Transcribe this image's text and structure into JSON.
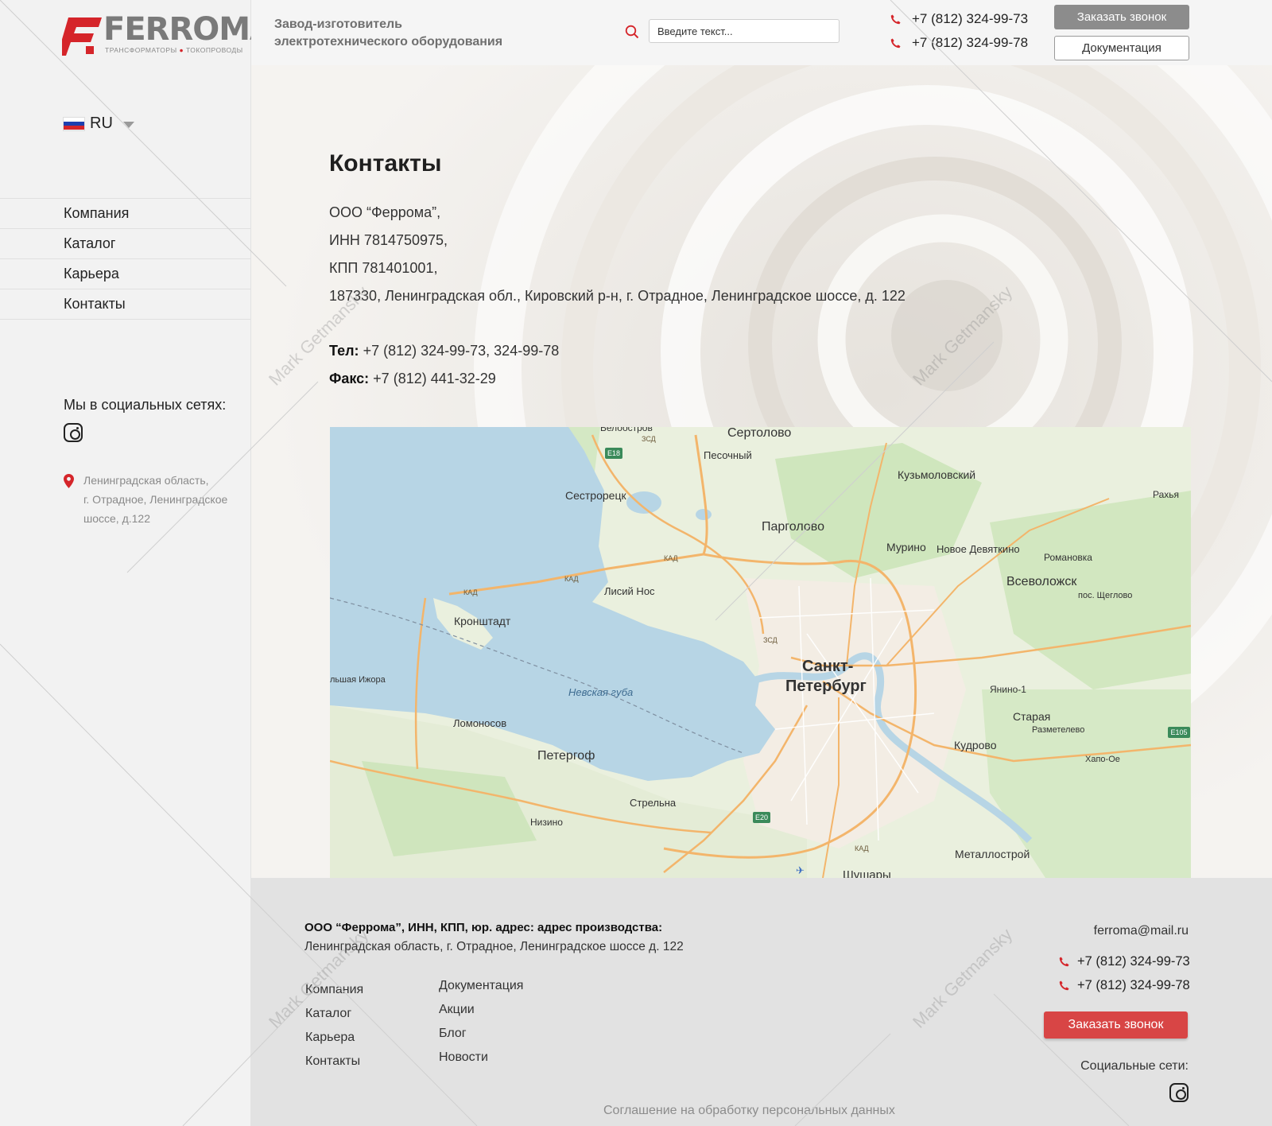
{
  "brand": {
    "name": "FERROMA",
    "sub_left": "ТРАНСФОРМАТОРЫ",
    "sub_right": "ТОКОПРОВОДЫ",
    "accent": "#d5252a"
  },
  "header": {
    "tagline_line1": "Завод-изготовитель",
    "tagline_line2": "электротехнического оборудования",
    "search_placeholder": "Введите текст...",
    "phones": [
      "+7 (812) 324-99-73",
      "+7 (812) 324-99-78"
    ],
    "callback_label": "Заказать звонок",
    "docs_label": "Документация"
  },
  "language": {
    "code": "RU",
    "flag": "russia-flag"
  },
  "sidebar": {
    "nav": [
      "Компания",
      "Каталог",
      "Карьера",
      "Контакты"
    ],
    "social_title": "Мы в социальных сетях:",
    "address_lines": [
      "Ленинградская область,",
      "г. Отрадное, Ленинградское",
      "шоссе, д.122"
    ]
  },
  "contacts": {
    "title": "Контакты",
    "company": "ООО “Феррома”,",
    "inn": "ИНН 7814750975,",
    "kpp": "КПП 781401001,",
    "address": "187330, Ленинградская обл., Кировский р-н, г. Отрадное, Ленинградское шоссе, д. 122",
    "tel_label": "Тел:",
    "tel_value": "+7 (812) 324-99-73, 324-99-78",
    "fax_label": "Факс:",
    "fax_value": "+7 (812) 441-32-29"
  },
  "map": {
    "labels": {
      "beloostrov": "Белоостров",
      "sertolovo": "Сертолово",
      "pesochny": "Песочный",
      "kuzmolovsky": "Кузьмоловский",
      "rakhya": "Рахья",
      "sestroretsk": "Сестрорецк",
      "pargolovo": "Парголово",
      "murino": "Мурино",
      "novoe_devyatkino": "Новое Девяткино",
      "romanovka": "Романовка",
      "vsevolozhsk": "Всеволожск",
      "shcheglovo": "пос. Щеглово",
      "lisiy_nos": "Лисий Нос",
      "kronshtadt": "Кронштадт",
      "spb_line1": "Санкт-",
      "spb_line2": "Петербург",
      "yanino": "Янино-1",
      "staraya": "Старая",
      "razmetelevo": "Разметелево",
      "bolshaya_izhora": "льшая Ижора",
      "nevskaya_guba": "Невская губа",
      "lomonosov": "Ломоносов",
      "peterhof": "Петергоф",
      "kudrovo": "Кудрово",
      "khapo_oe": "Хапо-Ое",
      "strelna": "Стрельна",
      "nizino": "Низино",
      "metallostroy": "Металлострой",
      "shushary": "Шушары",
      "kad": "КАД",
      "zsd": "ЗСД",
      "e18": "E18",
      "e20": "E20",
      "e105": "E105"
    }
  },
  "footer": {
    "company_line": "ООО “Феррома”, ИНН, КПП, юр. адрес:  адрес производства:",
    "address_line": "Ленинградская область, г. Отрадное, Ленинградское шоссе д. 122",
    "nav_col1": [
      "Компания",
      "Каталог",
      "Карьера",
      "Контакты"
    ],
    "nav_col2": [
      "Документация",
      "Акции",
      "Блог",
      "Новости"
    ],
    "email": "ferroma@mail.ru",
    "phones": [
      "+7 (812) 324-99-73",
      "+7 (812) 324-99-78"
    ],
    "callback_label": "Заказать звонок",
    "social_title": "Социальные сети:",
    "agreement": "Соглашение на обработку персональных данных"
  },
  "watermark": "Mark Getmansky"
}
